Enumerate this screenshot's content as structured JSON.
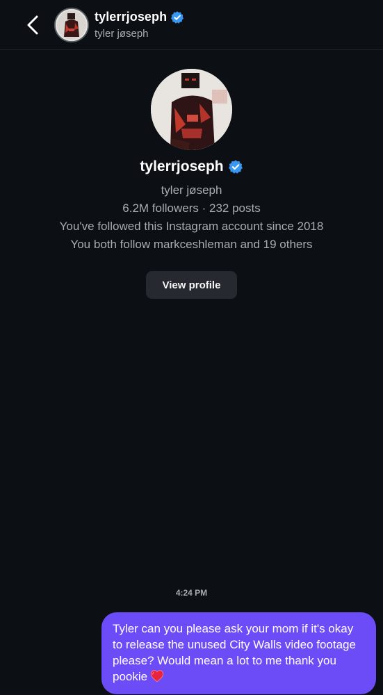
{
  "header": {
    "username": "tylerrjoseph",
    "full_name": "tyler jøseph",
    "verified": true,
    "back_icon": "chevron-left-icon",
    "verified_icon": "verified-badge-icon"
  },
  "profile": {
    "username": "tylerrjoseph",
    "full_name": "tyler jøseph",
    "stats": "6.2M followers · 232 posts",
    "follow_since": "You've followed this Instagram account since 2018",
    "mutuals": "You both follow markceshleman and 19 others",
    "view_profile_label": "View profile"
  },
  "conversation": {
    "timestamp": "4:24 PM",
    "messages": [
      {
        "direction": "outgoing",
        "text": "Tyler can you please ask your mom if it's okay to release the unused City Walls video footage please? Would mean a lot to me thank you pookie",
        "emoji": "red-heart-icon"
      }
    ]
  },
  "colors": {
    "background": "#0c1014",
    "bubble": "#6b4cf6",
    "verified": "#3897f0",
    "button": "#262a30",
    "secondary_text": "#a8adb3"
  }
}
